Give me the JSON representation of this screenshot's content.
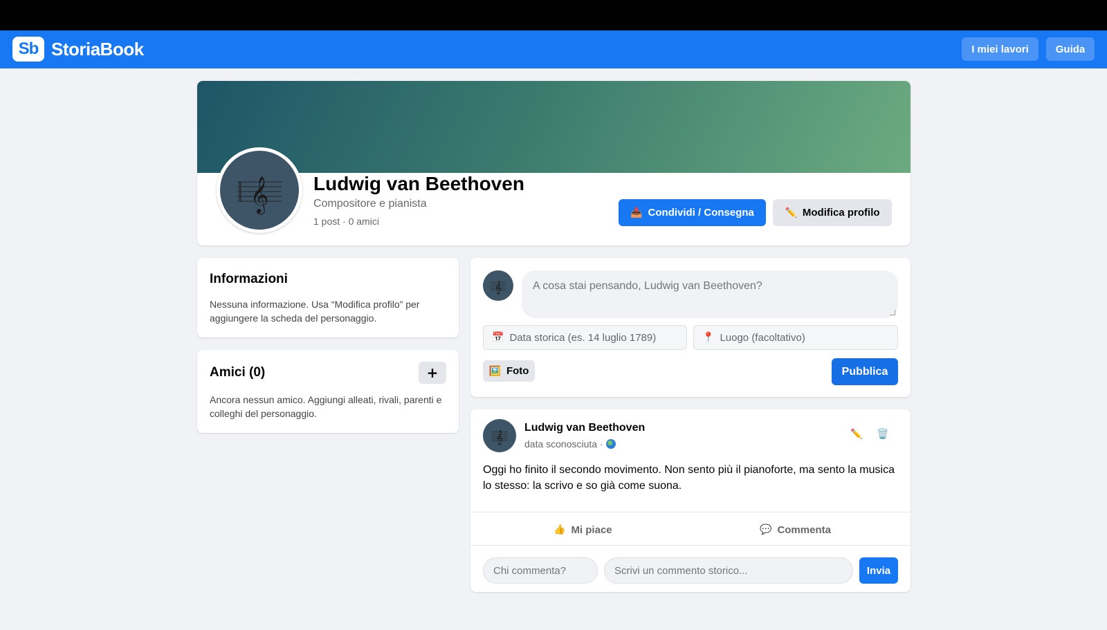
{
  "app": {
    "logo_mark": "Sb",
    "name": "StoriaBook",
    "nav": {
      "my_works": "I miei lavori",
      "guide": "Guida"
    },
    "colors": {
      "brand": "#1877f2",
      "page_bg": "#f0f2f5"
    }
  },
  "profile": {
    "name": "Ludwig van Beethoven",
    "role": "Compositore e pianista",
    "stats": "1 post · 0 amici",
    "avatar_icon": "treble-clef-icon",
    "share_label": "Condividi / Consegna",
    "edit_label": "Modifica profilo"
  },
  "info": {
    "title": "Informazioni",
    "text": "Nessuna informazione. Usa “Modifica profilo” per aggiungere la scheda del personaggio."
  },
  "friends": {
    "title": "Amici (0)",
    "add_label": "+",
    "text": "Ancora nessun amico. Aggiungi alleati, rivali, parenti e colleghi del personaggio."
  },
  "composer": {
    "placeholder": "A cosa stai pensando, Ludwig van Beethoven?",
    "date_placeholder": "Data storica (es. 14 luglio 1789)",
    "place_placeholder": "Luogo (facoltativo)",
    "photo_label": "Foto",
    "publish_label": "Pubblica"
  },
  "post": {
    "author": "Ludwig van Beethoven",
    "date": "data sconosciuta ·",
    "text": "Oggi ho finito il secondo movimento. Non sento più il pianoforte, ma sento la musica lo stesso: la scrivo e so già come suona.",
    "like_label": "Mi piace",
    "comment_label": "Commenta",
    "who_placeholder": "Chi commenta?",
    "comment_placeholder": "Scrivi un commento storico...",
    "send_label": "Invia"
  }
}
